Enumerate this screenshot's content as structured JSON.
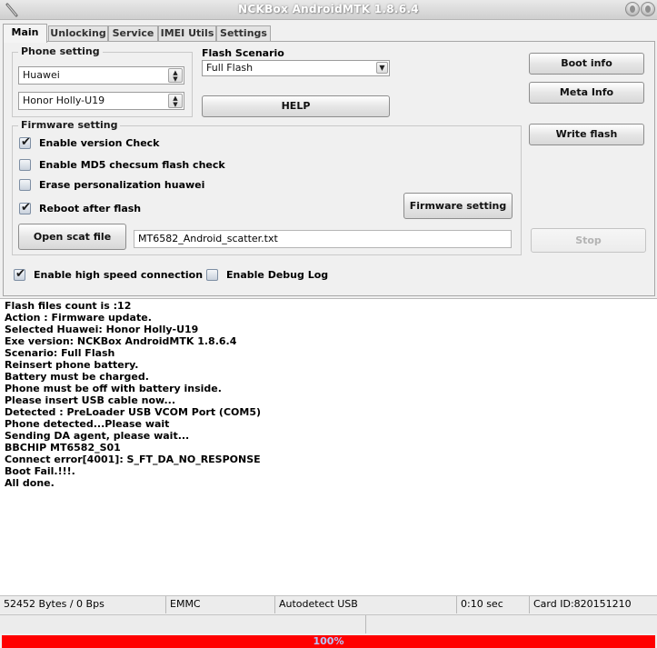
{
  "window": {
    "title": "NCKBox AndroidMTK 1.8.6.4"
  },
  "tabs": [
    {
      "label": "Main",
      "active": true
    },
    {
      "label": "Unlocking",
      "active": false
    },
    {
      "label": "Service",
      "active": false
    },
    {
      "label": "IMEI Utils",
      "active": false
    },
    {
      "label": "Settings",
      "active": false
    }
  ],
  "phone_setting": {
    "label": "Phone setting",
    "brand": "Huawei",
    "model": "Honor Holly-U19"
  },
  "flash_scenario": {
    "label": "Flash Scenario",
    "value": "Full Flash"
  },
  "help_button": "HELP",
  "side_buttons": {
    "boot_info": "Boot info",
    "meta_info": "Meta Info",
    "write_flash": "Write flash",
    "stop": "Stop"
  },
  "firmware_setting": {
    "label": "Firmware setting",
    "options": [
      {
        "label": "Enable version Check",
        "checked": true
      },
      {
        "label": "Enable MD5 checsum flash check",
        "checked": false
      },
      {
        "label": "Erase personalization huawei",
        "checked": false
      },
      {
        "label": "Reboot after flash",
        "checked": true
      }
    ],
    "firmware_button": "Firmware setting",
    "open_scat_button": "Open scat file",
    "scat_file": "MT6582_Android_scatter.txt"
  },
  "bottom_options": [
    {
      "label": "Enable high speed connection",
      "checked": true
    },
    {
      "label": "Enable Debug Log",
      "checked": false
    }
  ],
  "log": [
    "Flash files count is :12",
    "Action : Firmware update.",
    "Selected Huawei: Honor Holly-U19",
    "Exe version: NCKBox AndroidMTK 1.8.6.4",
    "Scenario: Full Flash",
    "Reinsert phone battery.",
    "Battery must be charged.",
    "Phone must be off with battery inside.",
    "Please insert USB cable now...",
    "Detected : PreLoader USB VCOM Port (COM5)",
    "Phone detected...Please wait",
    "Sending DA agent, please wait...",
    "BBCHIP MT6582_S01",
    "Connect error[4001]: S_FT_DA_NO_RESPONSE",
    "Boot Fail.!!!.",
    "All done."
  ],
  "status": {
    "bytes": "52452 Bytes / 0 Bps",
    "storage": "EMMC",
    "port": "Autodetect USB",
    "time": "0:10 sec",
    "card": "Card ID:820151210"
  },
  "progress": {
    "percent": 100,
    "label": "100%",
    "color": "#ff0000"
  }
}
